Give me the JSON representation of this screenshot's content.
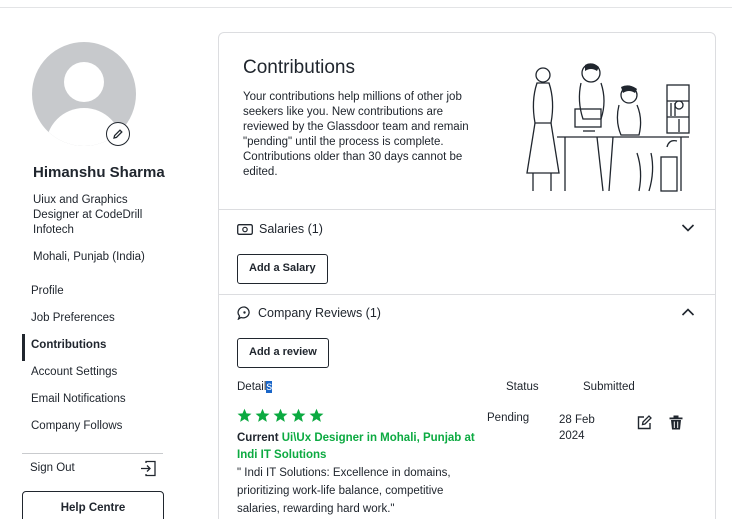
{
  "sidebar": {
    "name": "Himanshu Sharma",
    "title": "Uiux and Graphics Designer at CodeDrill Infotech",
    "location": "Mohali, Punjab (India)",
    "nav": [
      {
        "label": "Profile",
        "active": false
      },
      {
        "label": "Job Preferences",
        "active": false
      },
      {
        "label": "Contributions",
        "active": true
      },
      {
        "label": "Account Settings",
        "active": false
      },
      {
        "label": "Email Notifications",
        "active": false
      },
      {
        "label": "Company Follows",
        "active": false
      }
    ],
    "sign_out": "Sign Out",
    "help": "Help Centre"
  },
  "main": {
    "title": "Contributions",
    "description": "Your contributions help millions of other job seekers like you. New contributions are reviewed by the Glassdoor team and remain \"pending\" until the process is complete. Contributions older than 30 days cannot be edited.",
    "salaries": {
      "label": "Salaries (1)",
      "button": "Add a Salary"
    },
    "reviews": {
      "label": "Company Reviews (1)",
      "button": "Add a review",
      "col_details_a": "Detail",
      "col_details_b": "s",
      "col_status": "Status",
      "col_submitted": "Submitted",
      "rating": 5,
      "prefix": "Current",
      "role": "Ui\\Ux Designer",
      "in": "in Mohali, Punjab at",
      "company": "Indi IT Solutions",
      "text": "\" Indi IT Solutions: Excellence in domains, prioritizing work-life balance, competitive salaries, rewarding hard work.\"",
      "status": "Pending",
      "submitted": "28 Feb 2024"
    }
  },
  "colors": {
    "accent": "#0caa41",
    "text": "#20262e",
    "border": "#dcdde0"
  }
}
